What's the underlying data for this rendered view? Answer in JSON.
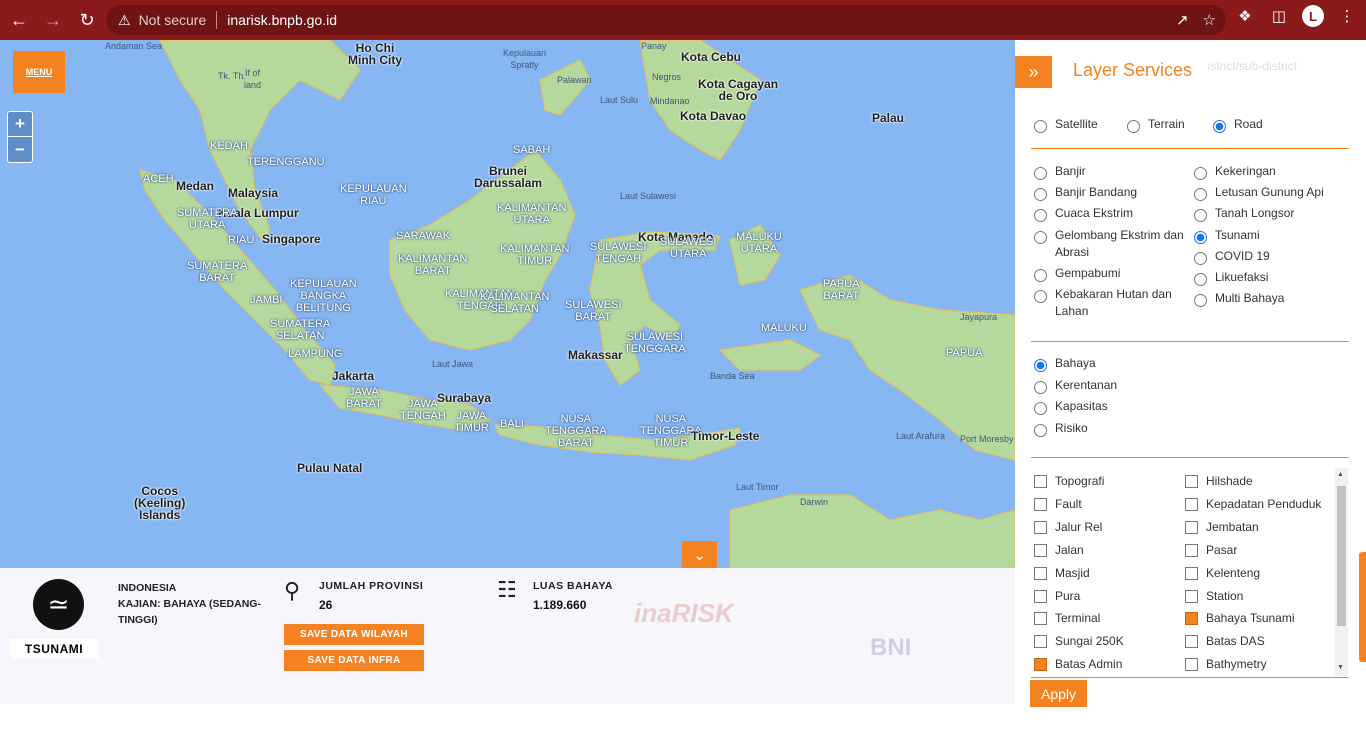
{
  "browser": {
    "security_label": "Not secure",
    "url": "inarisk.bnpb.go.id"
  },
  "map": {
    "menu_label": "MENU",
    "zoom_in": "+",
    "zoom_out": "−",
    "labels": [
      {
        "t": "Andaman Sea",
        "cls": "sea"
      },
      {
        "t": "Ho Chi\nMinh City",
        "cls": "dark"
      },
      {
        "t": "Kepulauan\nSpratly",
        "cls": "sea"
      },
      {
        "t": "Panay",
        "cls": "sea"
      },
      {
        "t": "Kota Cebu",
        "cls": "dark"
      },
      {
        "t": "Negros",
        "cls": "sea"
      },
      {
        "t": "Kota Cagayan\nde Oro",
        "cls": "dark"
      },
      {
        "t": "Palawan",
        "cls": "sea"
      },
      {
        "t": "Laut Sulu",
        "cls": "sea"
      },
      {
        "t": "Mindanao",
        "cls": "sea"
      },
      {
        "t": "Kota Davao",
        "cls": "dark"
      },
      {
        "t": "Palau",
        "cls": "dark"
      },
      {
        "t": "Tk. Th.",
        "cls": "sea"
      },
      {
        "t": "If of\nland",
        "cls": "sea"
      },
      {
        "t": "KEDAH",
        "cls": ""
      },
      {
        "t": "TERENGGANU",
        "cls": ""
      },
      {
        "t": "SABAH",
        "cls": ""
      },
      {
        "t": "Brunei\nDarussalam",
        "cls": "dark"
      },
      {
        "t": "Malaysia",
        "cls": "dark"
      },
      {
        "t": "ACEH",
        "cls": ""
      },
      {
        "t": "Medan",
        "cls": "dark"
      },
      {
        "t": "Kuala Lumpur",
        "cls": "dark"
      },
      {
        "t": "KEPULAUAN\nRIAU",
        "cls": ""
      },
      {
        "t": "KALIMANTAN\nUTARA",
        "cls": ""
      },
      {
        "t": "Laut Sulawesi",
        "cls": "sea"
      },
      {
        "t": "SUMATERA\nUTARA",
        "cls": ""
      },
      {
        "t": "RIAU",
        "cls": ""
      },
      {
        "t": "Singapore",
        "cls": "dark"
      },
      {
        "t": "SARAWAK",
        "cls": ""
      },
      {
        "t": "KALIMANTAN\nTIMUR",
        "cls": ""
      },
      {
        "t": "SULAWESI\nTENGAH",
        "cls": ""
      },
      {
        "t": "Kota Manado",
        "cls": "dark"
      },
      {
        "t": "SULAWESI\nUTARA",
        "cls": ""
      },
      {
        "t": "MALUKU\nUTARA",
        "cls": ""
      },
      {
        "t": "KALIMANTAN\nBARAT",
        "cls": ""
      },
      {
        "t": "SUMATERA\nBARAT",
        "cls": ""
      },
      {
        "t": "JAMBI",
        "cls": ""
      },
      {
        "t": "KEPULAUAN\nBANGKA\nBELITUNG",
        "cls": ""
      },
      {
        "t": "KALIMANTAN\nTENGAH",
        "cls": ""
      },
      {
        "t": "KALIMANTAN\nSELATAN",
        "cls": ""
      },
      {
        "t": "SULAWESI\nBARAT",
        "cls": ""
      },
      {
        "t": "PAPUA\nBARAT",
        "cls": ""
      },
      {
        "t": "Jayapura",
        "cls": "sea"
      },
      {
        "t": "SUMATERA\nSELATAN",
        "cls": ""
      },
      {
        "t": "SULAWESI\nTENGGARA",
        "cls": ""
      },
      {
        "t": "MALUKU",
        "cls": ""
      },
      {
        "t": "Makassar",
        "cls": "dark"
      },
      {
        "t": "LAMPUNG",
        "cls": ""
      },
      {
        "t": "PAPUA",
        "cls": ""
      },
      {
        "t": "Jakarta",
        "cls": "dark"
      },
      {
        "t": "Laut Jawa",
        "cls": "sea"
      },
      {
        "t": "Banda Sea",
        "cls": "sea"
      },
      {
        "t": "JAWA\nBARAT",
        "cls": ""
      },
      {
        "t": "JAWA\nTENGAH",
        "cls": ""
      },
      {
        "t": "Surabaya",
        "cls": "dark"
      },
      {
        "t": "JAWA\nTIMUR",
        "cls": ""
      },
      {
        "t": "BALI",
        "cls": ""
      },
      {
        "t": "NUSA\nTENGGARA\nBARAT",
        "cls": ""
      },
      {
        "t": "NUSA\nTENGGARA\nTIMUR",
        "cls": ""
      },
      {
        "t": "Timor-Leste",
        "cls": "dark"
      },
      {
        "t": "Laut Arafura",
        "cls": "sea"
      },
      {
        "t": "Port Moresby",
        "cls": "sea"
      },
      {
        "t": "Pulau Natal",
        "cls": "dark"
      },
      {
        "t": "Cocos\n(Keeling)\nIslands",
        "cls": "dark"
      },
      {
        "t": "Laut Timor",
        "cls": "sea"
      },
      {
        "t": "Darwin",
        "cls": "sea"
      }
    ]
  },
  "info": {
    "hazard_name": "TSUNAMI",
    "region_line1": "INDONESIA",
    "region_line2": "KAJIAN: BAHAYA (SEDANG-TINGGI)",
    "provinces_title": "JUMLAH PROVINSI",
    "provinces_value": "26",
    "area_title": "LUAS BAHAYA",
    "area_value": "1.189.660",
    "save_wilayah": "SAVE DATA WILAYAH",
    "save_infra": "SAVE DATA INFRA",
    "brand": "inaRISK",
    "bni": "BNI"
  },
  "panel": {
    "title": "Layer Services",
    "search_hint": "istrict/sub-district",
    "basemaps": [
      {
        "label": "Satellite",
        "selected": false
      },
      {
        "label": "Terrain",
        "selected": false
      },
      {
        "label": "Road",
        "selected": true
      }
    ],
    "hazards_left": [
      {
        "label": "Banjir",
        "selected": false
      },
      {
        "label": "Banjir Bandang",
        "selected": false
      },
      {
        "label": "Cuaca Ekstrim",
        "selected": false
      },
      {
        "label": "Gelombang Ekstrim dan Abrasi",
        "selected": false
      },
      {
        "label": "Gempabumi",
        "selected": false
      },
      {
        "label": "Kebakaran Hutan dan Lahan",
        "selected": false
      }
    ],
    "hazards_right": [
      {
        "label": "Kekeringan",
        "selected": false
      },
      {
        "label": "Letusan Gunung Api",
        "selected": false
      },
      {
        "label": "Tanah Longsor",
        "selected": false
      },
      {
        "label": "Tsunami",
        "selected": true
      },
      {
        "label": "COVID 19",
        "selected": false
      },
      {
        "label": "Likuefaksi",
        "selected": false
      },
      {
        "label": "Multi Bahaya",
        "selected": false
      }
    ],
    "studies": [
      {
        "label": "Bahaya",
        "selected": true
      },
      {
        "label": "Kerentanan",
        "selected": false
      },
      {
        "label": "Kapasitas",
        "selected": false
      },
      {
        "label": "Risiko",
        "selected": false
      }
    ],
    "layers_left": [
      {
        "label": "Topografi",
        "checked": false
      },
      {
        "label": "Fault",
        "checked": false
      },
      {
        "label": "Jalur Rel",
        "checked": false
      },
      {
        "label": "Jalan",
        "checked": false
      },
      {
        "label": "Masjid",
        "checked": false
      },
      {
        "label": "Pura",
        "checked": false
      },
      {
        "label": "Terminal",
        "checked": false
      },
      {
        "label": "Sungai 250K",
        "checked": false
      },
      {
        "label": "Batas Admin",
        "checked": true
      }
    ],
    "layers_right": [
      {
        "label": "Hilshade",
        "checked": false
      },
      {
        "label": "Kepadatan Penduduk",
        "checked": false
      },
      {
        "label": "Jembatan",
        "checked": false
      },
      {
        "label": "Pasar",
        "checked": false
      },
      {
        "label": "Kelenteng",
        "checked": false
      },
      {
        "label": "Station",
        "checked": false
      },
      {
        "label": "Bahaya Tsunami",
        "checked": true
      },
      {
        "label": "Batas DAS",
        "checked": false
      },
      {
        "label": "Bathymetry",
        "checked": false
      }
    ],
    "apply_label": "Apply"
  }
}
